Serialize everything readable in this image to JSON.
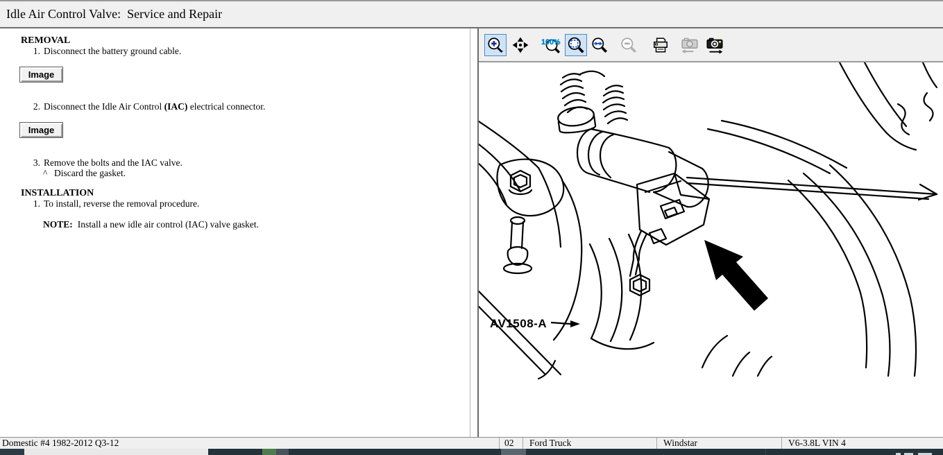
{
  "header": {
    "title": "Idle Air Control Valve:  Service and Repair"
  },
  "procedure": {
    "removal": {
      "heading": "REMOVAL",
      "image_button": "Image",
      "steps": {
        "s1": {
          "num": "1.",
          "text": "Disconnect the battery ground cable."
        },
        "s2": {
          "num": "2.",
          "pre": "Disconnect the Idle Air Control ",
          "bold": "(IAC)",
          "post": " electrical connector."
        },
        "s3": {
          "num": "3.",
          "text": "Remove the bolts and the IAC valve.",
          "bullet": "^",
          "sub": "Discard the gasket."
        }
      }
    },
    "installation": {
      "heading": "INSTALLATION",
      "steps": {
        "s1": {
          "num": "1.",
          "text": "To install, reverse the removal procedure."
        }
      },
      "note": {
        "label": "NOTE:",
        "text": "Install a new idle air control (IAC) valve gasket."
      }
    }
  },
  "toolbar": {
    "actual_size_label": "100%",
    "icons": [
      {
        "name": "zoom-in-icon",
        "state": "active"
      },
      {
        "name": "pan-icon",
        "state": "enabled"
      },
      {
        "name": "actual-size-icon",
        "state": "enabled"
      },
      {
        "name": "fit-page-icon",
        "state": "active"
      },
      {
        "name": "fit-width-icon",
        "state": "enabled"
      },
      {
        "name": "zoom-out-icon",
        "state": "disabled"
      },
      {
        "name": "print-icon",
        "state": "enabled"
      },
      {
        "name": "previous-image-icon",
        "state": "disabled"
      },
      {
        "name": "next-image-icon",
        "state": "enabled"
      }
    ]
  },
  "figure": {
    "label": "AV1508-A"
  },
  "status_bar": {
    "coverage": "Domestic #4 1982-2012 Q3-12",
    "fields": [
      "02",
      "Ford Truck",
      "Windstar",
      "V6-3.8L VIN 4"
    ]
  },
  "colors": {
    "chrome_bg": "#f0f0f0",
    "active_button_bg": "#cfe3f7",
    "active_button_border": "#4d88c4",
    "taskbar_dark": "#24323a",
    "taskbar_green": "#4e7d52"
  }
}
